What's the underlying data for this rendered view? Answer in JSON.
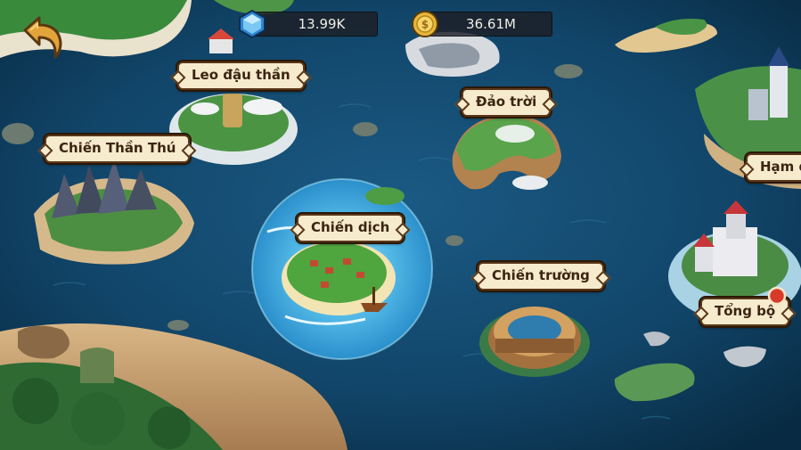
{
  "resources": {
    "gems": {
      "icon": "blue-gem-icon",
      "value": "13.99K"
    },
    "coins": {
      "icon": "gold-coin-icon",
      "value": "36.61M"
    }
  },
  "navigation": {
    "back_icon": "back-arrow-icon"
  },
  "locations": {
    "leo_dau_than": "Leo đậu thần",
    "dao_troi": "Đảo trời",
    "chien_than_thu": "Chiến Thần Thú",
    "ham_doi": "Hạm đ",
    "chien_dich": "Chiến dịch",
    "chien_truong": "Chiến trường",
    "tong_bo": "Tổng bộ"
  },
  "colors": {
    "ocean": "#0d3a58",
    "label_bg": "#f6ebcd",
    "label_border": "#5a3618",
    "notification": "#d83a2a"
  }
}
